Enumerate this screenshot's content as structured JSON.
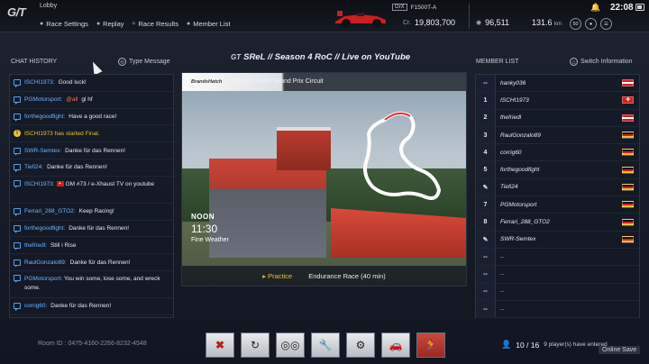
{
  "header": {
    "title": "Lobby",
    "nav": [
      {
        "label": "Race Settings",
        "icon": "settings-icon"
      },
      {
        "label": "Replay",
        "icon": "replay-icon"
      },
      {
        "label": "Race Results",
        "icon": "results-icon"
      },
      {
        "label": "Member List",
        "icon": "members-icon"
      }
    ],
    "car_class": "GrX",
    "car_name": "F1500T-A",
    "credits": "19,803,700",
    "credits_unit": "Cr.",
    "mileage": "96,511",
    "distance": "131.6",
    "distance_unit": "km",
    "mini_badge_1": "50",
    "clock": "22:08"
  },
  "chat": {
    "section_label": "CHAT HISTORY",
    "type_message": "Type Message",
    "messages": [
      {
        "user": "ISCHI1973:",
        "text": "Good luck!"
      },
      {
        "user": "PGMotorsport:",
        "mention": "@all",
        "text": "gl hf"
      },
      {
        "user": "forthegoodfight:",
        "text": "Have a good race!"
      },
      {
        "system": "ISCHI1973 has started Final."
      },
      {
        "user": "SWR-Semtex:",
        "text": "Danke für das Rennen!"
      },
      {
        "user": "Tiefi24:",
        "text": "Danke für das Rennen!"
      },
      {
        "user": "ISCHI1973:",
        "text": "GM #73 / e-Xhaust TV on youtube"
      },
      {
        "user": "Ferrari_288_GTO2:",
        "text": "Keep Racing!"
      },
      {
        "user": "forthegoodfight:",
        "text": "Danke für das Rennen!"
      },
      {
        "user": "thefriedl:",
        "text": "Still i Rise"
      },
      {
        "user": "RaulGonzalo89:",
        "text": "Danke für das Rennen!"
      },
      {
        "user": "PGMotorsport:",
        "text": "You win some, lose some, and wreck some."
      },
      {
        "user": "corrig60:",
        "text": "Danke für das Rennen!"
      }
    ]
  },
  "lobby": {
    "title": "SReL // Season 4 RoC // Live on YouTube",
    "track_logo": "BrandsHatch",
    "track_name": "Brands Hatch Grand Prix Circuit",
    "time_of_day": "NOON",
    "time": "11:30",
    "weather": "Fine Weather",
    "session": "Practice",
    "race": "Endurance Race (40 min)"
  },
  "members": {
    "section_label": "MEMBER LIST",
    "switch_info": "Switch Information",
    "rows": [
      {
        "num": "--",
        "name": "hanky036",
        "flag": "at"
      },
      {
        "num": "1",
        "name": "ISCHI1973",
        "flag": "ch"
      },
      {
        "num": "2",
        "name": "thefriedl",
        "flag": "at"
      },
      {
        "num": "3",
        "name": "RaulGonzalo89",
        "flag": "de"
      },
      {
        "num": "4",
        "name": "corrig60",
        "flag": "de"
      },
      {
        "num": "5",
        "name": "forthegoodfight",
        "flag": "de"
      },
      {
        "num": "✎",
        "name": "Tiefi24",
        "flag": "de"
      },
      {
        "num": "7",
        "name": "PGMotorsport",
        "flag": "de"
      },
      {
        "num": "8",
        "name": "Ferrari_288_GTO2",
        "flag": "de"
      },
      {
        "num": "✎",
        "name": "SWR-Semtex",
        "flag": "de"
      },
      {
        "num": "--",
        "name": "--",
        "flag": ""
      },
      {
        "num": "--",
        "name": "--",
        "flag": ""
      },
      {
        "num": "--",
        "name": "--",
        "flag": ""
      },
      {
        "num": "--",
        "name": "--",
        "flag": ""
      }
    ]
  },
  "footer": {
    "room_id": "Room ID : 0475-4160-2266-8232-4548",
    "players": "10 / 16",
    "players_note": "9 player(s) have entered",
    "online_save": "Online Save"
  }
}
